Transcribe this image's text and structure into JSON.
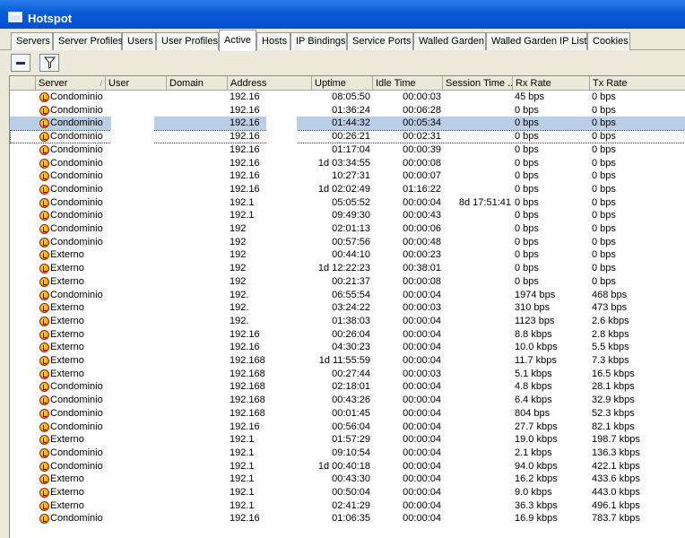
{
  "window": {
    "title": "Hotspot"
  },
  "tabs": [
    {
      "label": "Servers",
      "active": false
    },
    {
      "label": "Server Profiles",
      "active": false
    },
    {
      "label": "Users",
      "active": false
    },
    {
      "label": "User Profiles",
      "active": false
    },
    {
      "label": "Active",
      "active": true
    },
    {
      "label": "Hosts",
      "active": false
    },
    {
      "label": "IP Bindings",
      "active": false
    },
    {
      "label": "Service Ports",
      "active": false
    },
    {
      "label": "Walled Garden",
      "active": false
    },
    {
      "label": "Walled Garden IP List",
      "active": false
    },
    {
      "label": "Cookies",
      "active": false
    }
  ],
  "toolbar": {
    "remove_icon": "minus-icon",
    "filter_icon": "filter-icon"
  },
  "columns": [
    "Server",
    "User",
    "Domain",
    "Address",
    "Uptime",
    "Idle Time",
    "Session Time ...",
    "Rx Rate",
    "Tx Rate"
  ],
  "rows": [
    {
      "server": "Condominio",
      "user": "",
      "address": "192.16",
      "uptime": "08:05:50",
      "idle": "00:00:03",
      "session": "",
      "rx": "45 bps",
      "tx": "0 bps"
    },
    {
      "server": "Condominio",
      "user": "",
      "address": "192.16",
      "uptime": "01:36:24",
      "idle": "00:06:28",
      "session": "",
      "rx": "0 bps",
      "tx": "0 bps"
    },
    {
      "server": "Condominio",
      "user": "",
      "address": "192.16",
      "uptime": "01:44:32",
      "idle": "00:05:34",
      "session": "",
      "rx": "0 bps",
      "tx": "0 bps"
    },
    {
      "server": "Condominio",
      "user": "",
      "address": "192.16",
      "uptime": "00:26:21",
      "idle": "00:02:31",
      "session": "",
      "rx": "0 bps",
      "tx": "0 bps"
    },
    {
      "server": "Condominio",
      "user": "",
      "address": "192.16",
      "uptime": "01:17:04",
      "idle": "00:00:39",
      "session": "",
      "rx": "0 bps",
      "tx": "0 bps"
    },
    {
      "server": "Condominio",
      "user": "",
      "address": "192.16",
      "uptime": "1d 03:34:55",
      "idle": "00:00:08",
      "session": "",
      "rx": "0 bps",
      "tx": "0 bps"
    },
    {
      "server": "Condominio",
      "user": "",
      "address": "192.16",
      "uptime": "10:27:31",
      "idle": "00:00:07",
      "session": "",
      "rx": "0 bps",
      "tx": "0 bps"
    },
    {
      "server": "Condominio",
      "user": "",
      "address": "192.16",
      "uptime": "1d 02:02:49",
      "idle": "01:16:22",
      "session": "",
      "rx": "0 bps",
      "tx": "0 bps"
    },
    {
      "server": "Condominio",
      "user": "",
      "address": "192.1",
      "uptime": "05:05:52",
      "idle": "00:00:04",
      "session": "8d 17:51:41",
      "rx": "0 bps",
      "tx": "0 bps"
    },
    {
      "server": "Condominio",
      "user": "",
      "address": "192.1",
      "uptime": "09:49:30",
      "idle": "00:00:43",
      "session": "",
      "rx": "0 bps",
      "tx": "0 bps"
    },
    {
      "server": "Condominio",
      "user": "",
      "address": "192",
      "uptime": "02:01:13",
      "idle": "00:00:06",
      "session": "",
      "rx": "0 bps",
      "tx": "0 bps"
    },
    {
      "server": "Condominio",
      "user": "",
      "address": "192",
      "uptime": "00:57:56",
      "idle": "00:00:48",
      "session": "",
      "rx": "0 bps",
      "tx": "0 bps"
    },
    {
      "server": "Externo",
      "user": "",
      "address": "192",
      "uptime": "00:44:10",
      "idle": "00:00:23",
      "session": "",
      "rx": "0 bps",
      "tx": "0 bps"
    },
    {
      "server": "Externo",
      "user": "",
      "address": "192",
      "uptime": "1d 12:22:23",
      "idle": "00:38:01",
      "session": "",
      "rx": "0 bps",
      "tx": "0 bps"
    },
    {
      "server": "Externo",
      "user": "",
      "address": "192",
      "uptime": "00:21:37",
      "idle": "00:00:08",
      "session": "",
      "rx": "0 bps",
      "tx": "0 bps"
    },
    {
      "server": "Condominio",
      "user": "",
      "address": "192.",
      "uptime": "06:55:54",
      "idle": "00:00:04",
      "session": "",
      "rx": "1974 bps",
      "tx": "468 bps"
    },
    {
      "server": "Externo",
      "user": "",
      "address": "192.",
      "uptime": "03:24:22",
      "idle": "00:00:03",
      "session": "",
      "rx": "310 bps",
      "tx": "473 bps"
    },
    {
      "server": "Externo",
      "user": "",
      "address": "192.",
      "uptime": "01:38:03",
      "idle": "00:00:04",
      "session": "",
      "rx": "1123 bps",
      "tx": "2.6 kbps"
    },
    {
      "server": "Externo",
      "user": "",
      "address": "192.16",
      "uptime": "00:26:04",
      "idle": "00:00:04",
      "session": "",
      "rx": "8.8 kbps",
      "tx": "2.8 kbps"
    },
    {
      "server": "Externo",
      "user": "",
      "address": "192.16",
      "uptime": "04:30:23",
      "idle": "00:00:04",
      "session": "",
      "rx": "10.0 kbps",
      "tx": "5.5 kbps"
    },
    {
      "server": "Externo",
      "user": "",
      "address": "192.168",
      "uptime": "1d 11:55:59",
      "idle": "00:00:04",
      "session": "",
      "rx": "11.7 kbps",
      "tx": "7.3 kbps"
    },
    {
      "server": "Externo",
      "user": "",
      "address": "192.168",
      "uptime": "00:27:44",
      "idle": "00:00:03",
      "session": "",
      "rx": "5.1 kbps",
      "tx": "16.5 kbps"
    },
    {
      "server": "Condominio",
      "user": "",
      "address": "192.168",
      "uptime": "02:18:01",
      "idle": "00:00:04",
      "session": "",
      "rx": "4.8 kbps",
      "tx": "28.1 kbps"
    },
    {
      "server": "Condominio",
      "user": "",
      "address": "192.168",
      "uptime": "00:43:26",
      "idle": "00:00:04",
      "session": "",
      "rx": "6.4 kbps",
      "tx": "32.9 kbps"
    },
    {
      "server": "Condominio",
      "user": "",
      "address": "192.168",
      "uptime": "00:01:45",
      "idle": "00:00:04",
      "session": "",
      "rx": "804 bps",
      "tx": "52.3 kbps"
    },
    {
      "server": "Condominio",
      "user": "",
      "address": "192.16",
      "uptime": "00:56:04",
      "idle": "00:00:04",
      "session": "",
      "rx": "27.7 kbps",
      "tx": "82.1 kbps"
    },
    {
      "server": "Externo",
      "user": "",
      "address": "192.1",
      "uptime": "01:57:29",
      "idle": "00:00:04",
      "session": "",
      "rx": "19.0 kbps",
      "tx": "198.7 kbps"
    },
    {
      "server": "Condominio",
      "user": "",
      "address": "192.1",
      "uptime": "09:10:54",
      "idle": "00:00:04",
      "session": "",
      "rx": "2.1 kbps",
      "tx": "136.3 kbps"
    },
    {
      "server": "Condominio",
      "user": "",
      "address": "192.1",
      "uptime": "1d 00:40:18",
      "idle": "00:00:04",
      "session": "",
      "rx": "94.0 kbps",
      "tx": "422.1 kbps"
    },
    {
      "server": "Externo",
      "user": "",
      "address": "192.1",
      "uptime": "00:43:30",
      "idle": "00:00:04",
      "session": "",
      "rx": "16.2 kbps",
      "tx": "433.6 kbps"
    },
    {
      "server": "Externo",
      "user": "",
      "address": "192.1",
      "uptime": "00:50:04",
      "idle": "00:00:04",
      "session": "",
      "rx": "9.0 kbps",
      "tx": "443.0 kbps"
    },
    {
      "server": "Externo",
      "user": "",
      "address": "192.1",
      "uptime": "02:41:29",
      "idle": "00:00:04",
      "session": "",
      "rx": "36.3 kbps",
      "tx": "496.1 kbps"
    },
    {
      "server": "Condominio",
      "user": "",
      "address": "192.16",
      "uptime": "01:06:35",
      "idle": "00:00:04",
      "session": "",
      "rx": "16.9 kbps",
      "tx": "783.7 kbps"
    }
  ],
  "selected_row": 2
}
